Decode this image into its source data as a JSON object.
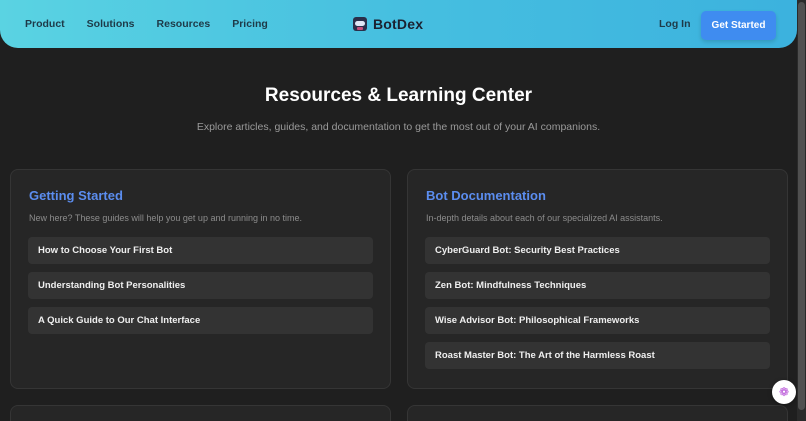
{
  "nav": {
    "links": [
      "Product",
      "Solutions",
      "Resources",
      "Pricing"
    ],
    "brand": "BotDex",
    "login_label": "Log In",
    "cta_label": "Get Started"
  },
  "hero": {
    "title": "Resources & Learning Center",
    "subtitle": "Explore articles, guides, and documentation to get the most out of your AI companions."
  },
  "cards": [
    {
      "title": "Getting Started",
      "description": "New here? These guides will help you get up and running in no time.",
      "items": [
        "How to Choose Your First Bot",
        "Understanding Bot Personalities",
        "A Quick Guide to Our Chat Interface"
      ]
    },
    {
      "title": "Bot Documentation",
      "description": "In-depth details about each of our specialized AI assistants.",
      "items": [
        "CyberGuard Bot: Security Best Practices",
        "Zen Bot: Mindfulness Techniques",
        "Wise Advisor Bot: Philosophical Frameworks",
        "Roast Master Bot: The Art of the Harmless Roast"
      ]
    }
  ],
  "icons": {
    "brand_logo": "robot-icon",
    "chat_fab": "brain-icon"
  },
  "colors": {
    "nav_gradient_start": "#5ad3e2",
    "nav_gradient_end": "#3cb2de",
    "cta": "#3f8cf0",
    "accent_title": "#5b8def",
    "background": "#1f1f1f",
    "card": "#262626"
  }
}
